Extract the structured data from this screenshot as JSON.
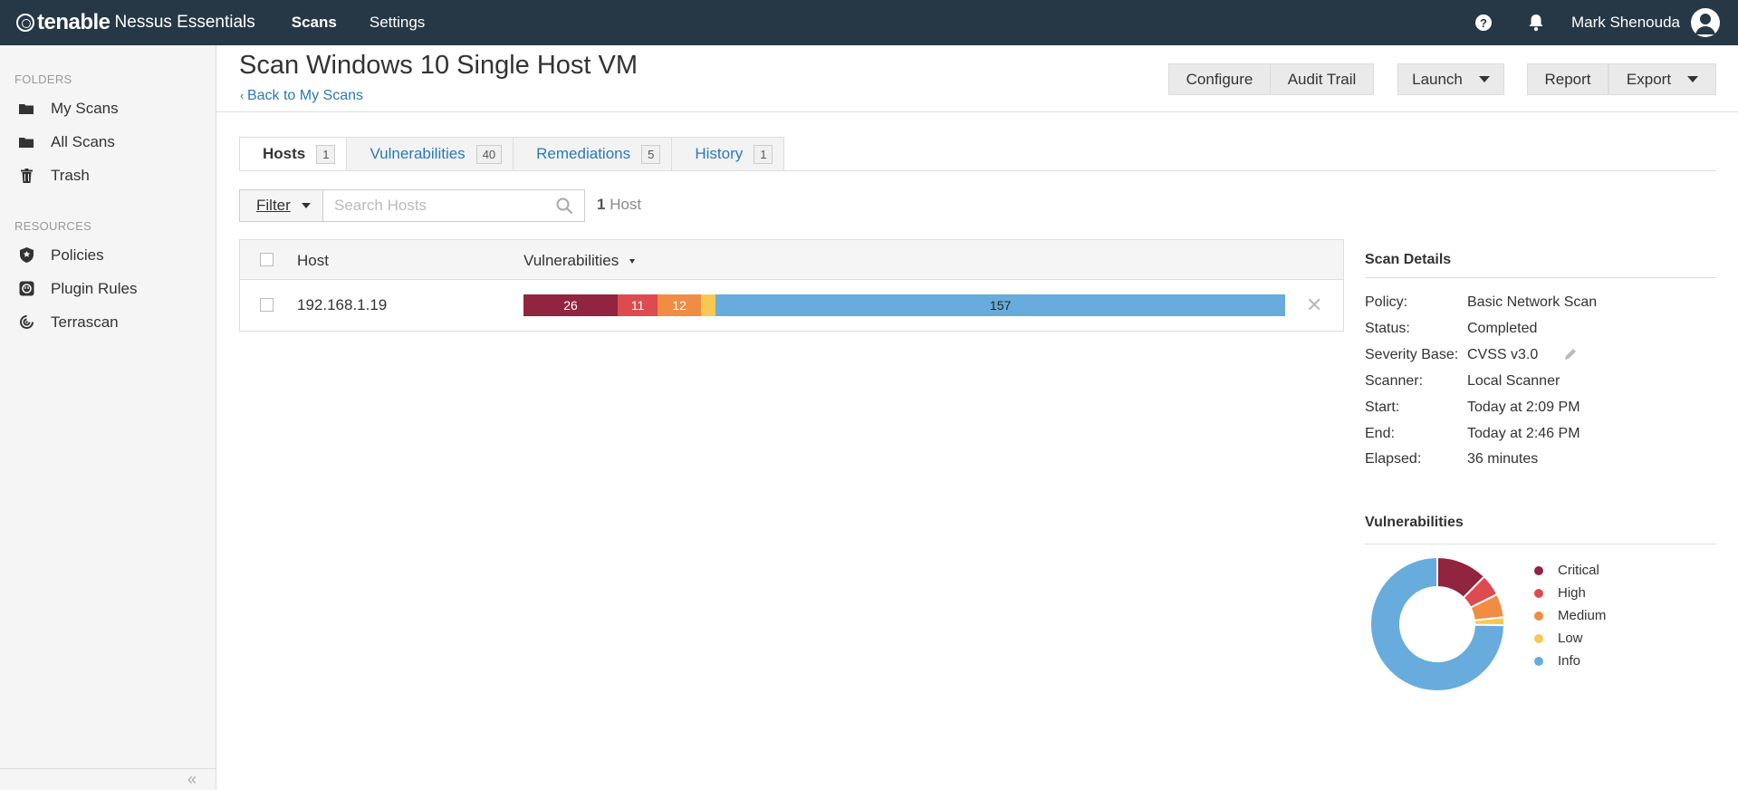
{
  "topbar": {
    "brand": "tenable",
    "product": "Nessus Essentials",
    "nav": [
      "Scans",
      "Settings"
    ],
    "user": "Mark Shenouda"
  },
  "sidebar": {
    "folders_heading": "FOLDERS",
    "folders": [
      "My Scans",
      "All Scans",
      "Trash"
    ],
    "resources_heading": "RESOURCES",
    "resources": [
      "Policies",
      "Plugin Rules",
      "Terrascan"
    ],
    "collapse": "«"
  },
  "header": {
    "title": "Scan Windows 10 Single Host VM",
    "back": "Back to My Scans",
    "buttons": {
      "configure": "Configure",
      "audit_trail": "Audit Trail",
      "launch": "Launch",
      "report": "Report",
      "export": "Export"
    }
  },
  "tabs": [
    {
      "label": "Hosts",
      "count": "1"
    },
    {
      "label": "Vulnerabilities",
      "count": "40"
    },
    {
      "label": "Remediations",
      "count": "5"
    },
    {
      "label": "History",
      "count": "1"
    }
  ],
  "filter": {
    "label": "Filter",
    "search_placeholder": "Search Hosts",
    "count": "1",
    "count_label": "Host"
  },
  "table": {
    "columns": [
      "Host",
      "Vulnerabilities"
    ],
    "rows": [
      {
        "host": "192.168.1.19",
        "severity": [
          {
            "level": "critical",
            "count": 26,
            "label": "26"
          },
          {
            "level": "high",
            "count": 11,
            "label": "11"
          },
          {
            "level": "medium",
            "count": 12,
            "label": "12"
          },
          {
            "level": "low",
            "count": 4,
            "label": ""
          },
          {
            "level": "info",
            "count": 157,
            "label": "157"
          }
        ]
      }
    ]
  },
  "details": {
    "title": "Scan Details",
    "rows": [
      {
        "k": "Policy:",
        "v": "Basic Network Scan"
      },
      {
        "k": "Status:",
        "v": "Completed"
      },
      {
        "k": "Severity Base:",
        "v": "CVSS v3.0"
      },
      {
        "k": "Scanner:",
        "v": "Local Scanner"
      },
      {
        "k": "Start:",
        "v": "Today at 2:09 PM"
      },
      {
        "k": "End:",
        "v": "Today at 2:46 PM"
      },
      {
        "k": "Elapsed:",
        "v": "36 minutes"
      }
    ]
  },
  "vuln_panel": {
    "title": "Vulnerabilities",
    "legend": [
      "Critical",
      "High",
      "Medium",
      "Low",
      "Info"
    ]
  },
  "colors": {
    "critical": "#91243e",
    "high": "#dd4b50",
    "medium": "#f18c43",
    "low": "#f8c851",
    "info": "#67acdd",
    "topbar": "#263746",
    "link": "#2a7ab8"
  }
}
